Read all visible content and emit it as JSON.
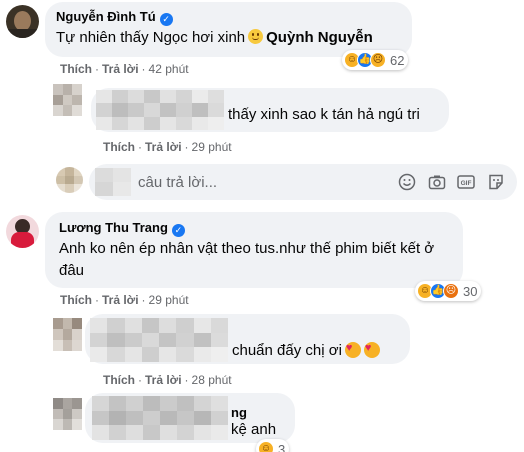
{
  "comments": [
    {
      "author": "Nguyễn Đình Tú",
      "text": "Tự nhiên thấy Ngọc hơi xinh",
      "mention": "Quỳnh Nguyễn",
      "actions": {
        "like": "Thích",
        "reply": "Trả lời",
        "time": "42 phút"
      },
      "reactions": [
        "haha-icon",
        "like-icon",
        "sad-icon"
      ],
      "reaction_count": "62"
    },
    {
      "author": "Lương Thu Trang",
      "text_line1": "Anh ko nên ép nhân vật theo tus.như thế phim biết kết ở",
      "text_line2": "đâu",
      "actions": {
        "like": "Thích",
        "reply": "Trả lời",
        "time": "29 phút"
      },
      "reactions": [
        "haha-icon",
        "like-icon",
        "angry-icon"
      ],
      "reaction_count": "30"
    }
  ],
  "replies": [
    {
      "text": "thấy xinh sao k tán hả ngú tri",
      "actions": {
        "like": "Thích",
        "reply": "Trả lời",
        "time": "29 phút"
      }
    },
    {
      "text": "chuẩn đấy chị ơi",
      "actions": {
        "like": "Thích",
        "reply": "Trả lời",
        "time": "28 phút"
      }
    },
    {
      "author_fragment": "ng",
      "text": "kệ anh",
      "reaction_count": "3"
    }
  ],
  "reply_box": {
    "placeholder": "câu trả lời...",
    "tools": [
      "emoji-icon",
      "camera-icon",
      "gif-icon",
      "sticker-icon"
    ]
  },
  "colors": {
    "bubble": "#f0f2f5",
    "meta": "#65676b",
    "verified": "#1877f2"
  }
}
